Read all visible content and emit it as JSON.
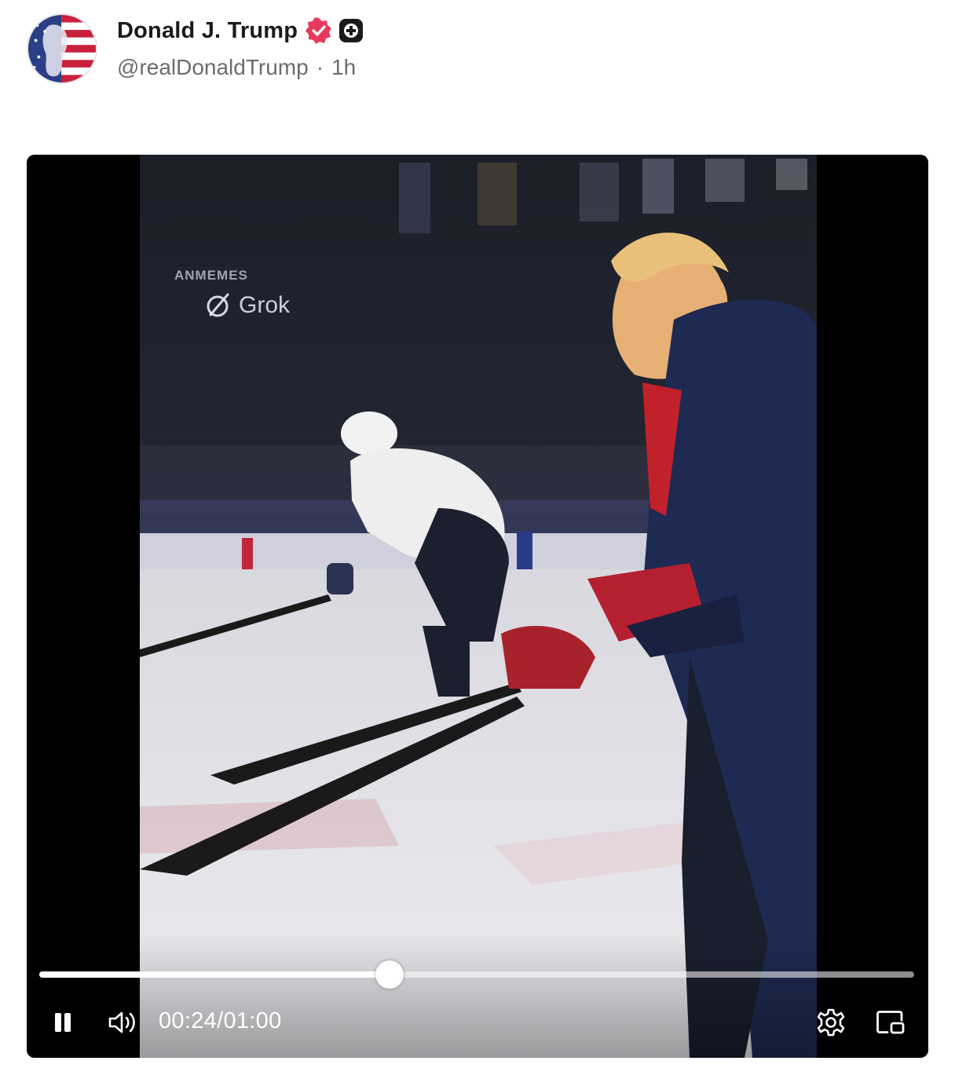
{
  "post": {
    "author_name": "Donald J. Trump",
    "handle": "@realDonaldTrump",
    "separator": "·",
    "time_ago": "1h",
    "badges": [
      "verified-icon",
      "plus-icon"
    ]
  },
  "video": {
    "watermark_text": "ANMEMES",
    "watermark_brand": "Grok",
    "current_time": "00:24",
    "time_separator": "/",
    "duration": "01:00",
    "progress_fraction": 0.4,
    "controls": [
      "pause-icon",
      "volume-icon",
      "settings-icon",
      "picture-in-picture-icon"
    ]
  },
  "colors": {
    "verified_badge": "#e8395d",
    "name_text": "#1b1b1b",
    "handle_text": "#6c6c6c",
    "player_bg": "#000000"
  }
}
